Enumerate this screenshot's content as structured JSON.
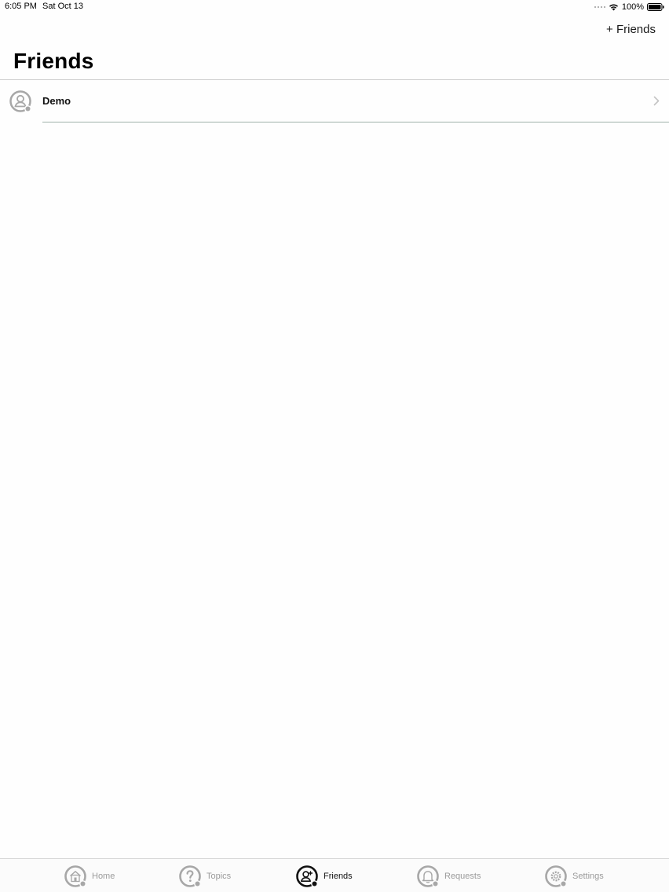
{
  "status_bar": {
    "time": "6:05 PM",
    "date": "Sat Oct 13",
    "battery": "100%"
  },
  "nav": {
    "add_button_label": "+ Friends",
    "title": "Friends"
  },
  "friends": [
    {
      "name": "Demo",
      "icon": "person-badge-icon"
    }
  ],
  "tab_bar": {
    "tabs": [
      {
        "label": "Home",
        "icon": "home-icon",
        "active": false
      },
      {
        "label": "Topics",
        "icon": "question-icon",
        "active": false
      },
      {
        "label": "Friends",
        "icon": "friends-icon",
        "active": true
      },
      {
        "label": "Requests",
        "icon": "bell-icon",
        "active": false
      },
      {
        "label": "Settings",
        "icon": "gear-icon",
        "active": false
      }
    ]
  },
  "colors": {
    "inactive": "#9b9b9b",
    "active": "#111111",
    "separator": "#9fb1aa"
  }
}
